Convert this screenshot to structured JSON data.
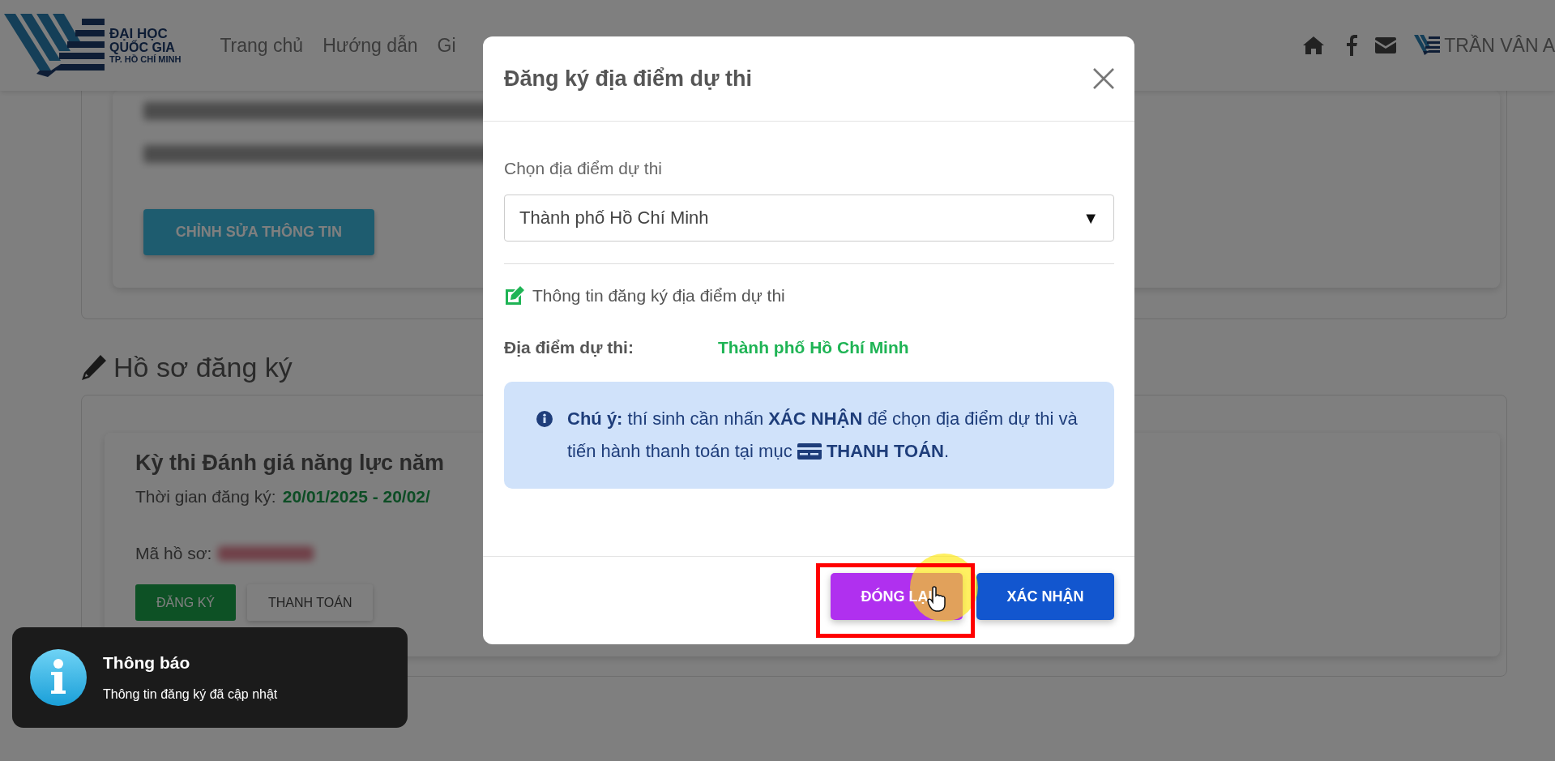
{
  "header": {
    "logo_lines": [
      "ĐẠI HỌC",
      "QUỐC GIA",
      "TP. HỒ CHÍ MINH"
    ],
    "nav": [
      "Trang chủ",
      "Hướng dẫn",
      "Gi"
    ],
    "user_name": "TRẦN VÂN A"
  },
  "profile_card": {
    "edit_button": "CHỈNH SỬA THÔNG TIN"
  },
  "applications": {
    "heading": "Hồ sơ đăng ký",
    "exam_title": "Kỳ thi Đánh giá năng lực năm",
    "period_label": "Thời gian đăng ký:",
    "period_value": "20/01/2025 - 20/02/",
    "code_label": "Mã hồ sơ:",
    "buttons": [
      {
        "label": "ĐĂNG KÝ",
        "kind": "primary"
      },
      {
        "label": "THANH TOÁN",
        "kind": "plain"
      }
    ]
  },
  "modal": {
    "title": "Đăng ký địa điểm dự thi",
    "select": {
      "label": "Chọn địa điểm dự thi",
      "value": "Thành phố Hồ Chí Minh",
      "arrow": "▼"
    },
    "section_title": "Thông tin đăng ký địa điểm dự thi",
    "field": {
      "label": "Địa điểm dự thi:",
      "value": "Thành phố Hồ Chí Minh"
    },
    "note": {
      "text": "**Chú ý:** thí sinh cần nhấn **XÁC NHẬN** để chọn địa điểm dự thi và tiến hành thanh toán tại mục",
      "section": "**THANH TOÁN**."
    },
    "buttons": [
      {
        "label": "ĐÓNG LẠI",
        "kind": "close",
        "highlighted": true
      },
      {
        "label": "XÁC NHẬN",
        "kind": "confirm",
        "highlighted": false
      }
    ]
  },
  "toast": {
    "title": "Thông báo",
    "message": "Thông tin đăng ký đã cập nhật"
  }
}
